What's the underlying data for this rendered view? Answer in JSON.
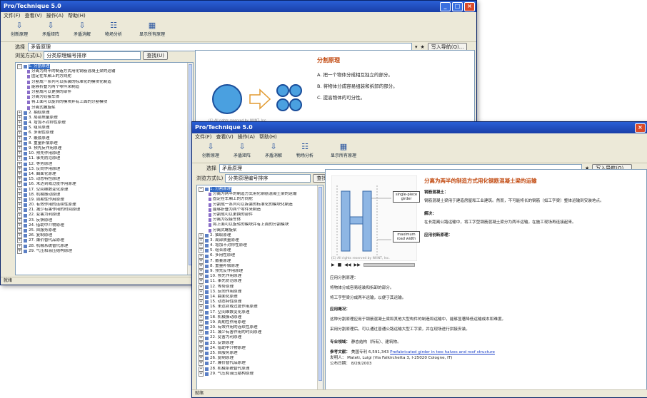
{
  "window_title": "Pro/Technique 5.0",
  "window_controls": {
    "minimize": "_",
    "maximize": "□",
    "close": "×"
  },
  "menu": [
    "文件(F)",
    "查看(V)",
    "操作(A)",
    "帮助(H)"
  ],
  "toolbar": [
    "创新原理",
    "矛盾矩阵",
    "矛盾消解",
    "物场分析",
    "技术进化",
    "效应知识库",
    "显示所有原理"
  ],
  "addr_label": "选择",
  "addr_value": "矛盾原理",
  "addr_star": "★",
  "addr_button": "写入导航(Q)...",
  "left_bar": {
    "label": "浏览方式(L)",
    "value": "分类原理编号排序",
    "button": "查找(U)"
  },
  "tree_root": "1. 分割原理",
  "tree_sub": [
    "分离为两半的制造方式用化钢筋混凝土梁的运输",
    "固定在车厢上的方向舵",
    "分割成一系列可以拆装的标准化的模块化制造",
    "能够折叠为两个零件来制造",
    "分割成可以更换的部件",
    "分离为铰接车体",
    "将上面可以旋转的模块并有上面的分割模块",
    "分离式螺旋桨"
  ],
  "tree_items": [
    "2. 抽取原理",
    "3. 局部质量原理",
    "4. 增加不对称性原理",
    "5. 组合原理",
    "6. 多用性原理",
    "7. 嵌套原理",
    "8. 重量补偿原理",
    "9. 预先反作用原理",
    "10. 预先作用原理",
    "11. 事先防范原理",
    "12. 等势原理",
    "13. 反向作用原理",
    "14. 曲面化原理",
    "15. 动态特性原理",
    "16. 未达到或过度作用原理",
    "17. 空间维数变化原理",
    "18. 机械振动原理",
    "19. 周期性作用原理",
    "20. 有效作用的连续性原理",
    "21. 减少有害作用的时间原理",
    "22. 变害为利原理",
    "23. 反馈原理",
    "24. 借助中介物原理",
    "25. 自服务原理",
    "26. 复制原理",
    "27. 廉价替代品原理",
    "28. 机械系统替代原理",
    "29. 气压和液压结构原理"
  ],
  "status": "就绪",
  "back": {
    "heading": "分割原理",
    "items": [
      "A. 把一个物体分成相互独立的部分。",
      "B. 将物体分成容易组装和拆卸的部分。",
      "C. 提高物体的可分性。"
    ],
    "caption": "(C) All rights reserved by IWINT, Inc."
  },
  "front": {
    "heading": "分离为两半的制造方式用化钢筋混凝土梁的运输",
    "sec1": "钢筋混凝土：",
    "p1": "钢筋混凝土梁用于建造房屋和工业建筑。然而，不可能将长的钢筋（如工字梁）整体运输到安装地点。",
    "sec2": "解决：",
    "p2": "在长距离公路运输中，将工字型钢筋混凝土梁分为两半运输，在施工现场再连接起来。",
    "sec3": "应用创新原理：",
    "s1": "应用分割原理：",
    "s2": "将物体分成容易组装和拆卸的部分。",
    "s3": "将工字型梁分成两半运输，以便于其运输。",
    "sec4": "应用概况：",
    "p3": "这种分割原理应用于钢筋混凝土梁和其他大型构件的制造和运输中，能够显著降低运输成本和难度。",
    "p4": "采用分割原理后，可以通过普通公路运输大型工字梁，并在现场进行拼接安装。",
    "expert_label": "专业领域：",
    "expert_value": "静态结构（所有）、建筑物。",
    "ref_label": "参考文献：",
    "ref_value": "美国专利 6,591,343",
    "ref_link": "Prefabricated girder in two halves and roof structure",
    "inv_label": "发明人：",
    "inv_value": "Mateti, Luigi (Via Falkirchetta 3, I-25020 Cologne, IT)",
    "date_label": "公布日期：",
    "date_value": "8/28/2003",
    "diagram": {
      "caption": "(C) All rights reserved by IWINT, Inc.",
      "label1": "single-piece girder",
      "label2": "maximum road width"
    },
    "media_controls": [
      "▶",
      "■",
      "◀◀",
      "▶▶"
    ]
  }
}
